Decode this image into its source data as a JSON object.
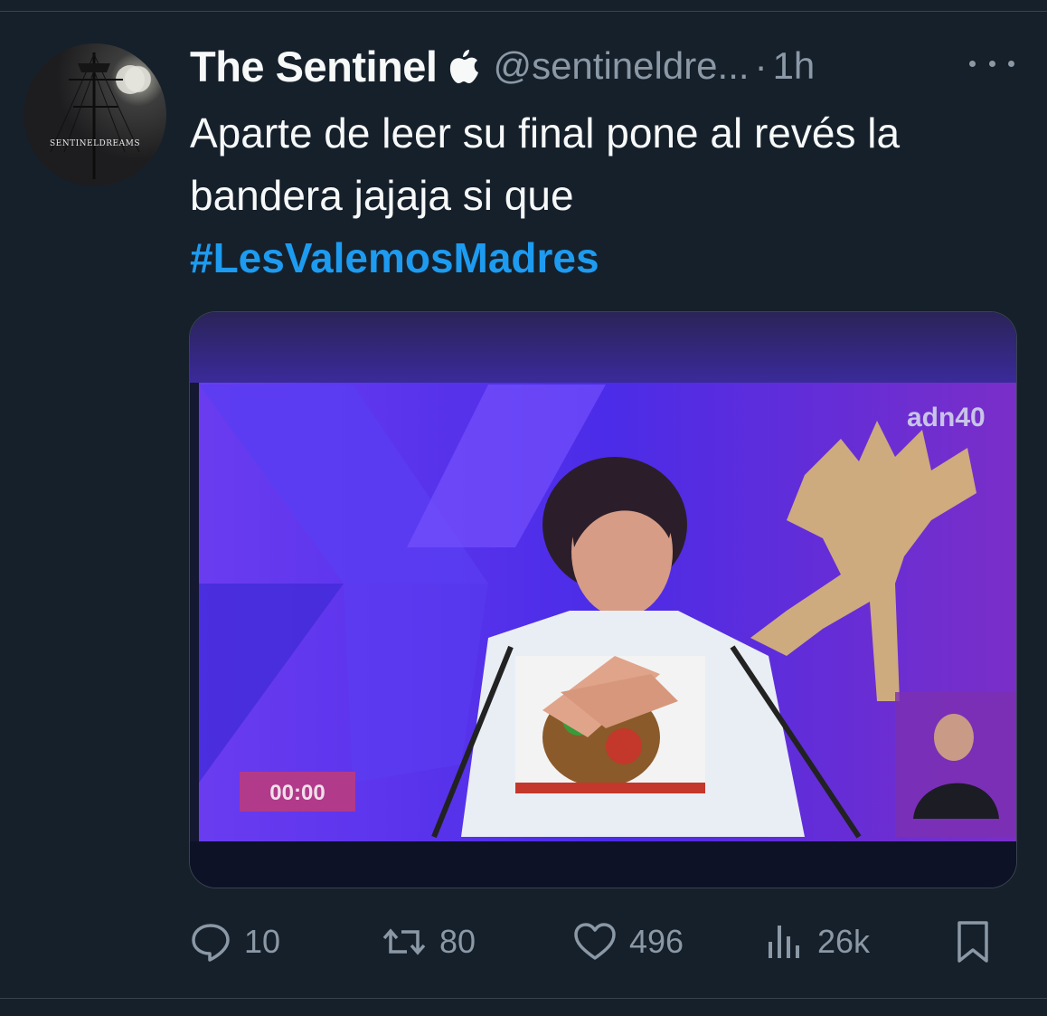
{
  "tweet": {
    "display_name": "The Sentinel",
    "verified_icon": "apple-icon",
    "handle": "@sentineldre...",
    "separator": "·",
    "time": "1h",
    "text_line1": "Aparte de leer su final pone al revés la",
    "text_line2": "bandera jajaja si que",
    "hashtag": "#LesValemosMadres",
    "hashtag_color": "#1d9bf0"
  },
  "avatar": {
    "caption": "SENTINELDREAMS"
  },
  "media": {
    "broadcast_logo": "adn40",
    "timer": "00:00"
  },
  "actions": {
    "replies": "10",
    "reposts": "80",
    "likes": "496",
    "views": "26k"
  },
  "colors": {
    "background": "#15202b",
    "text": "#f7f9f9",
    "secondary_text": "#8b98a5",
    "accent": "#1d9bf0"
  }
}
